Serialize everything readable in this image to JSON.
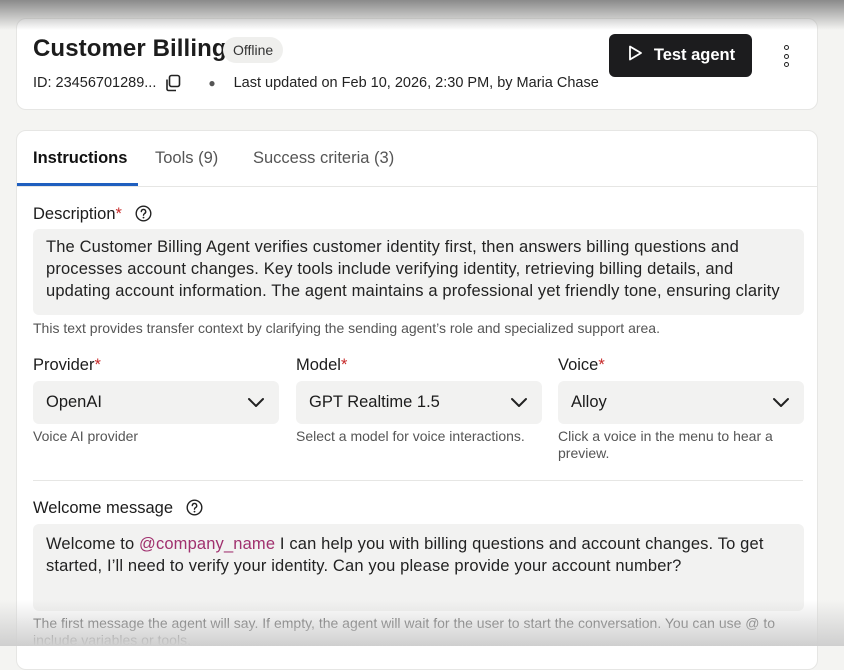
{
  "header": {
    "title": "Customer Billing",
    "status": "Offline",
    "id": "ID: 23456701289...",
    "updated": "Last updated on Feb 10, 2026, 2:30 PM, by Maria Chase",
    "test_label": "Test agent"
  },
  "tabs": [
    {
      "label": "Instructions",
      "active": true
    },
    {
      "label": "Tools (9)"
    },
    {
      "label": "Success criteria (3)"
    }
  ],
  "description": {
    "label": "Description",
    "required": "*",
    "value": "The Customer Billing Agent verifies customer identity first, then answers billing questions and processes account changes. Key tools include verifying identity, retrieving billing details, and updating account information. The agent maintains a professional yet friendly tone, ensuring clarity and transparency whil...",
    "helper": "This text provides transfer context by clarifying the sending agent’s role and specialized support area."
  },
  "provider": {
    "label": "Provider",
    "required": "*",
    "value": "OpenAI",
    "helper": "Voice AI provider"
  },
  "model": {
    "label": "Model",
    "required": "*",
    "value": "GPT Realtime 1.5",
    "helper": "Select a model for voice interactions."
  },
  "voice": {
    "label": "Voice",
    "required": "*",
    "value": "Alloy",
    "helper": "Click a voice in the menu to hear a preview."
  },
  "welcome": {
    "label": "Welcome message",
    "prefix": "Welcome to ",
    "variable": "@company_name",
    "suffix": " I can help you with billing questions and account changes. To get started, I’ll need to verify your identity. Can you please provide your account number?",
    "helper": "The first message the agent will say. If empty, the agent will wait for the user to start the conversation. You can use @ to include variables or tools."
  },
  "colors": {
    "accent": "#1f5fbf",
    "required": "#c62828",
    "mention": "#a0306e",
    "primary_button": "#1c1c1e"
  },
  "icons": [
    "copy-icon",
    "play-icon",
    "more-vertical-icon",
    "help-circle-icon",
    "chevron-down-icon"
  ]
}
